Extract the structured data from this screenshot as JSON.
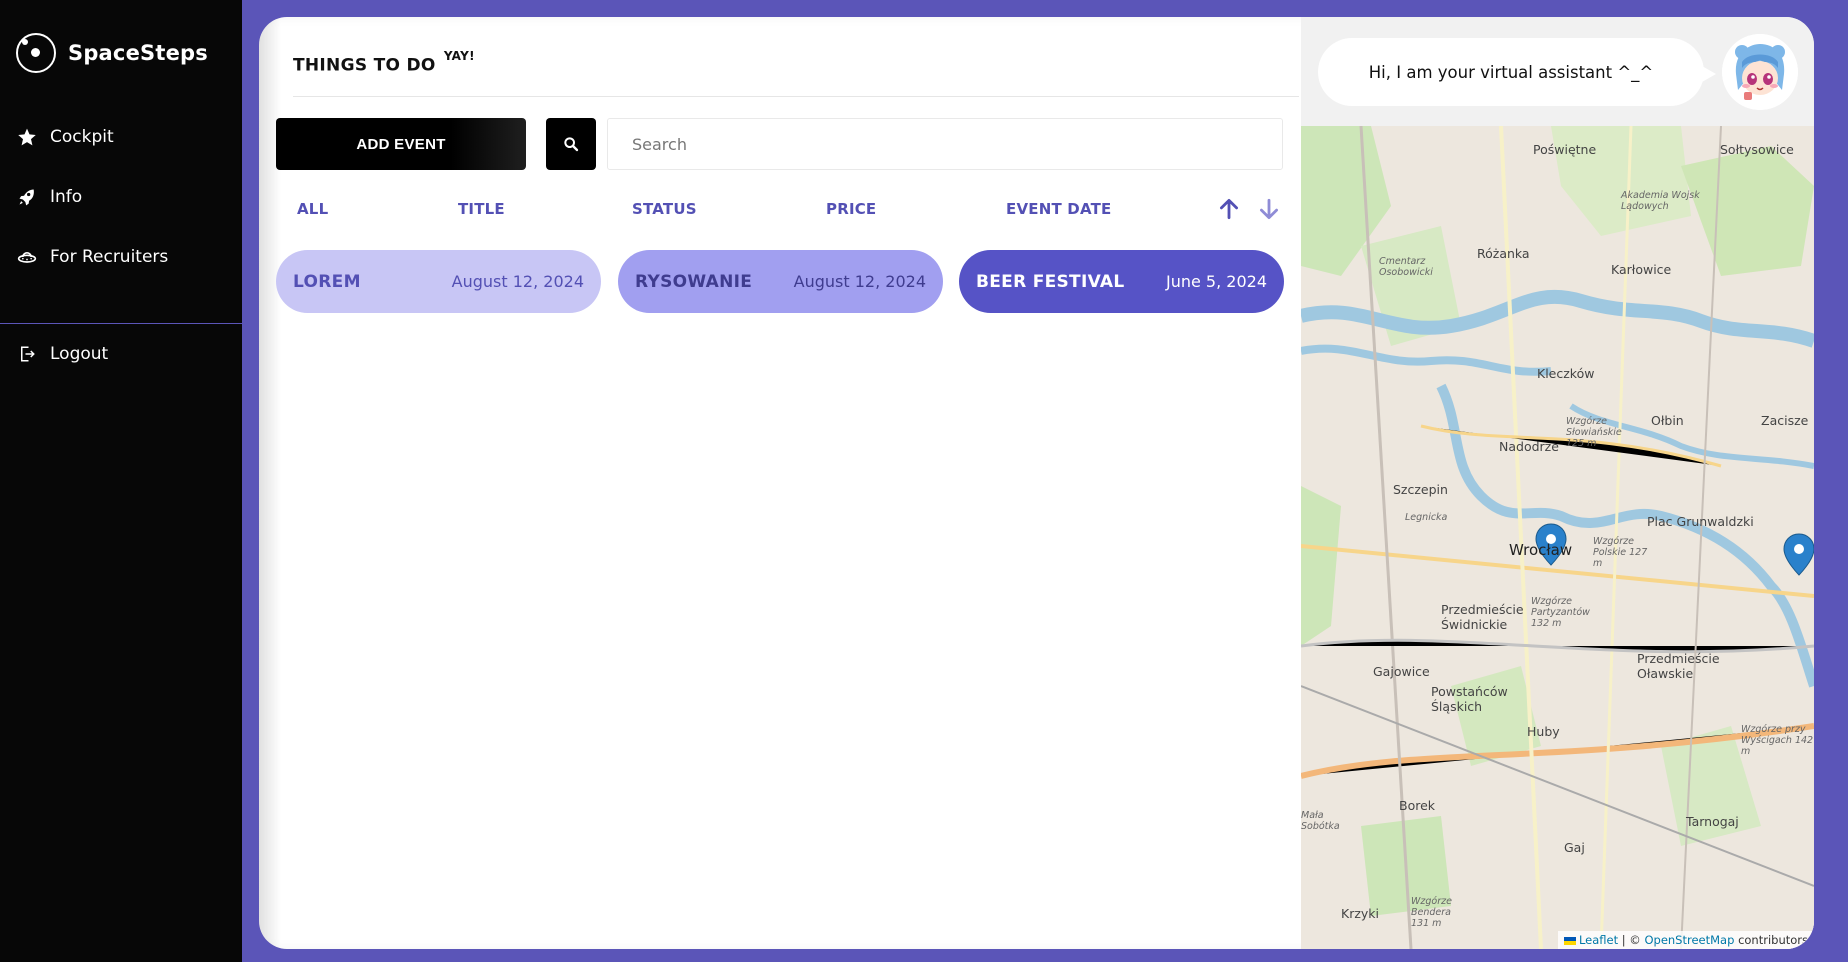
{
  "app": {
    "brand": "SpaceSteps"
  },
  "sidebar": {
    "items": [
      {
        "label": "Cockpit",
        "icon": "star-icon"
      },
      {
        "label": "Info",
        "icon": "rocket-icon"
      },
      {
        "label": "For Recruiters",
        "icon": "ufo-icon"
      }
    ],
    "logout_label": "Logout"
  },
  "main": {
    "title": "THINGS TO DO",
    "title_sup": "YAY!",
    "add_event_label": "ADD EVENT",
    "search": {
      "placeholder": "Search",
      "value": ""
    },
    "sort_headers": [
      "ALL",
      "TITLE",
      "STATUS",
      "PRICE",
      "EVENT DATE"
    ],
    "events": [
      {
        "title": "LOREM",
        "date": "August 12, 2024",
        "bg": "#c8c6f5",
        "fg": "#5350b4"
      },
      {
        "title": "RYSOWANIE",
        "date": "August 12, 2024",
        "bg": "#a19ff0",
        "fg": "#3f3c8f"
      },
      {
        "title": "BEER FESTIVAL",
        "date": "June 5, 2024",
        "bg": "#5653c6",
        "fg": "#ffffff"
      }
    ]
  },
  "assistant": {
    "greeting": "Hi, I am your virtual assistant ^_^"
  },
  "map": {
    "labels": [
      "Poświętne",
      "Sołtysowice",
      "Różanka",
      "Karłowice",
      "Kleczków",
      "Nadodrze",
      "Ołbin",
      "Zacisze",
      "Szczepin",
      "Plac Grunwaldzki",
      "Wrocław",
      "Przedmieście Świdnickie",
      "Przedmieście Oławskie",
      "Gajowice",
      "Powstańców Śląskich",
      "Huby",
      "Borek",
      "Tarnogaj",
      "Gaj",
      "Krzyki",
      "Mała Sobótka",
      "Akademia Wojsk Lądowych",
      "Cmentarz Osobowicki",
      "Wzgórze Słowiańskie 125 m",
      "Wzgórze Polskie 127 m",
      "Wzgórze Partyzantów 132 m",
      "Wzgórze przy Wyścigach 142 m",
      "Wzgórze Bendera 131 m",
      "Legnicka"
    ],
    "attribution": {
      "leaflet": "Leaflet",
      "sep": "| ©",
      "osm": "OpenStreetMap",
      "suffix": "contributors"
    }
  },
  "colors": {
    "accent": "#5b55b8",
    "header_text": "#5350b4",
    "sidebar_bg": "#070707"
  }
}
